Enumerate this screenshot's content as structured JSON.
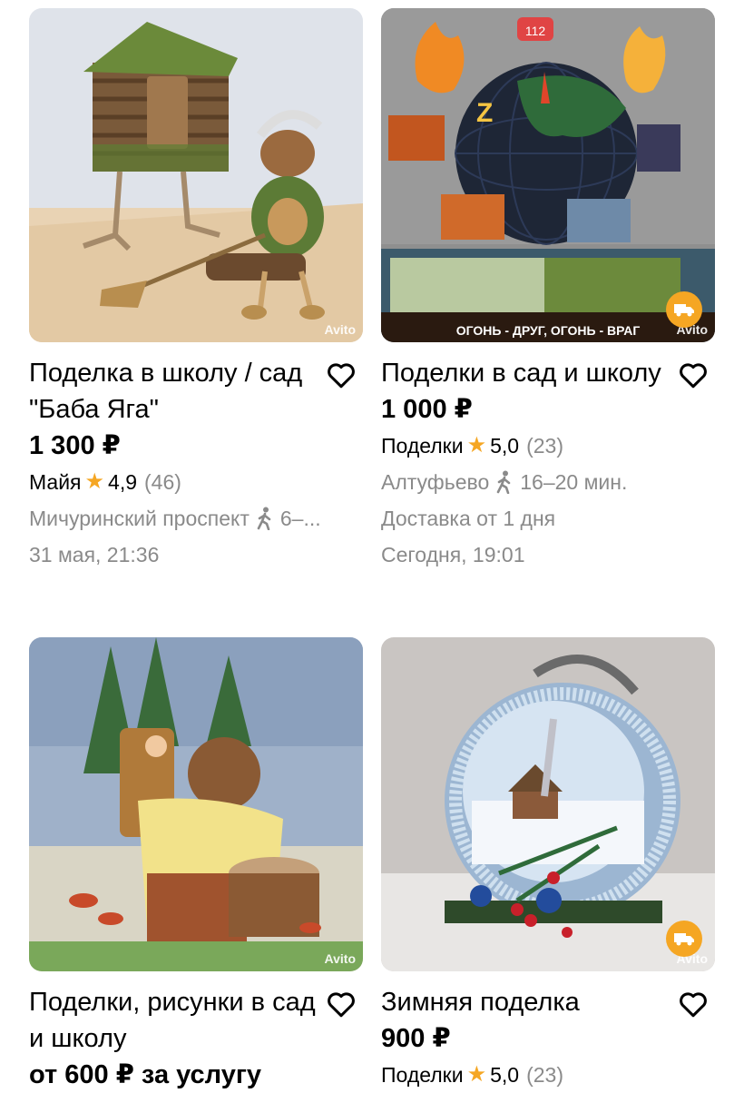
{
  "watermark": "Avito",
  "accent_color": "#f5a623",
  "items": [
    {
      "title": "Поделка в школу / сад \"Баба Яга\"",
      "price": "1 300 ₽",
      "seller": "Майя",
      "rating": "4,9",
      "reviews": "(46)",
      "location": "Мичуринский проспект",
      "walk_time": "6–...",
      "date": "31 мая, 21:36",
      "image_icon": "baba-yaga-craft-image"
    },
    {
      "title": "Поделки в сад и школу",
      "price": "1 000 ₽",
      "seller": "Поделки",
      "rating": "5,0",
      "reviews": "(23)",
      "location": "Алтуфьево",
      "walk_time": "16–20 мин.",
      "delivery": "Доставка от 1 дня",
      "date": "Сегодня, 19:01",
      "image_text": "ОГОНЬ - ДРУГ, ОГОНЬ - ВРАГ",
      "image_badge": "112",
      "image_icon": "fire-globe-craft-image",
      "delivery_icon": "truck-icon"
    },
    {
      "title": "Поделки, рисунки в сад и школу",
      "price": "от 600 ₽ за услугу",
      "image_icon": "bear-drawing-image"
    },
    {
      "title": "Зимняя поделка",
      "price": "900 ₽",
      "seller": "Поделки",
      "rating": "5,0",
      "reviews": "(23)",
      "image_icon": "winter-clock-craft-image",
      "delivery_icon": "truck-icon"
    }
  ]
}
